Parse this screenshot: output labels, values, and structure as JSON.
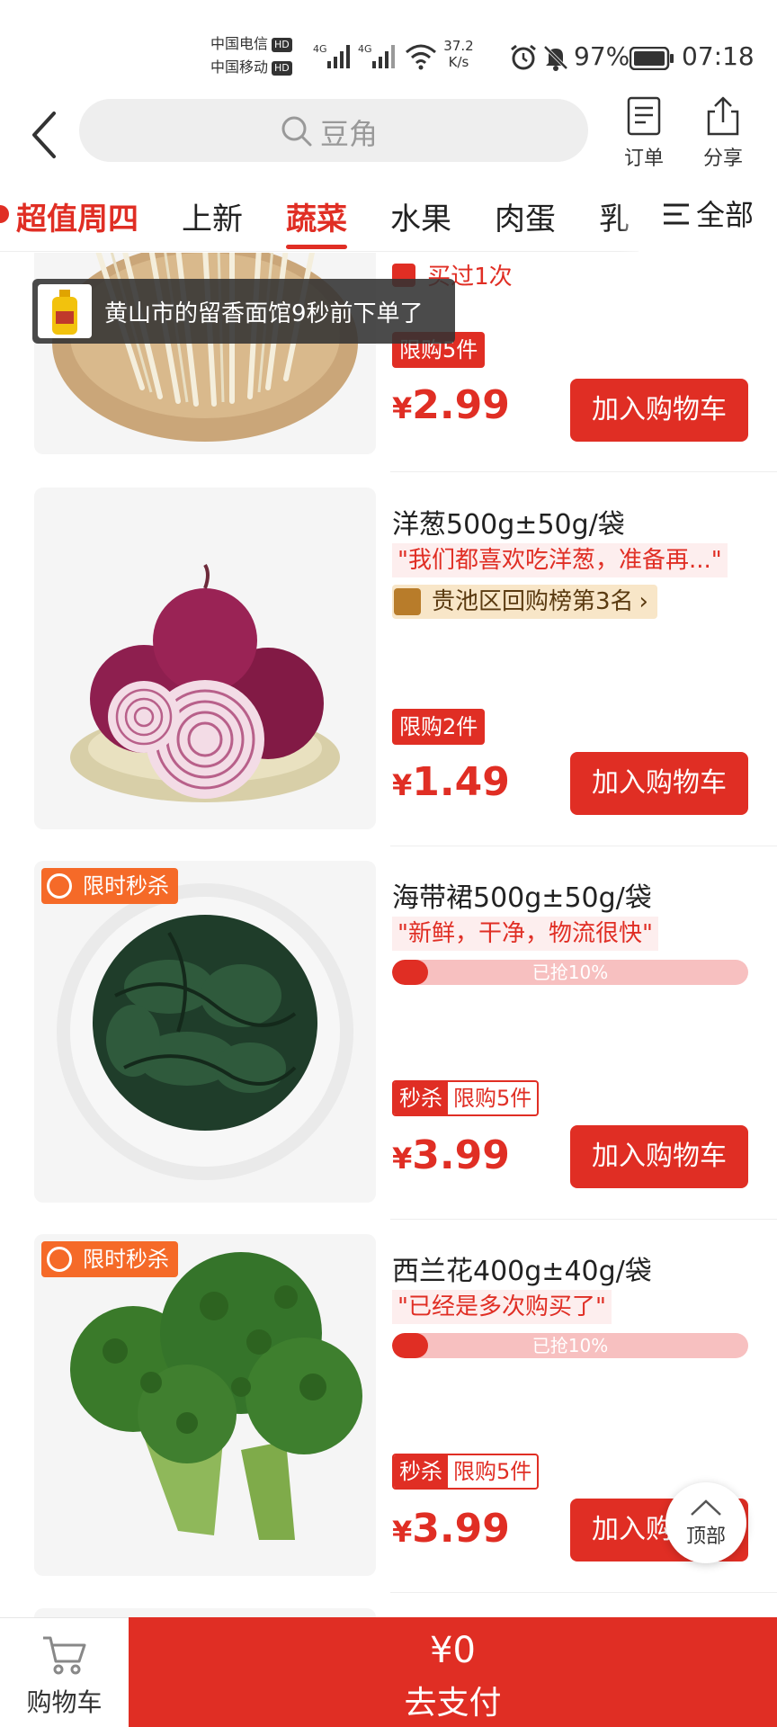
{
  "status": {
    "carrier1": "中国电信",
    "carrier2": "中国移动",
    "hd": "HD",
    "net1": "4G",
    "net2": "4G",
    "speed_val": "37.2",
    "speed_unit": "K/s",
    "battery": "97%",
    "time": "07:18"
  },
  "header": {
    "search_placeholder": "豆角",
    "orders_label": "订单",
    "share_label": "分享"
  },
  "categories": {
    "items": [
      "超值周四",
      "上新",
      "蔬菜",
      "水果",
      "肉蛋",
      "乳"
    ],
    "active": "蔬菜",
    "all_label": "全部"
  },
  "toast": {
    "text": "黄山市的留香面馆9秒前下单了"
  },
  "products": [
    {
      "bought_before": "买过1次",
      "limit": "限购5件",
      "currency": "¥",
      "price": "2.99",
      "add_label": "加入购物车"
    },
    {
      "name": "洋葱500g±50g/袋",
      "quote": "\"我们都喜欢吃洋葱，准备再...\"",
      "rank": "贵池区回购榜第3名",
      "limit": "限购2件",
      "currency": "¥",
      "price": "1.49",
      "add_label": "加入购物车"
    },
    {
      "flash_label": "限时秒杀",
      "name": "海带裙500g±50g/袋",
      "quote": "\"新鲜，干净，物流很快\"",
      "progress_text": "已抢10%",
      "progress": 0.1,
      "seckill": "秒杀",
      "limit": "限购5件",
      "currency": "¥",
      "price": "3.99",
      "add_label": "加入购物车"
    },
    {
      "flash_label": "限时秒杀",
      "name": "西兰花400g±40g/袋",
      "quote": "\"已经是多次购买了\"",
      "progress_text": "已抢10%",
      "progress": 0.1,
      "seckill": "秒杀",
      "limit": "限购5件",
      "currency": "¥",
      "price": "3.99",
      "add_label": "加入购物车"
    }
  ],
  "top_button": "顶部",
  "bottom": {
    "cart_label": "购物车",
    "total": "¥0",
    "pay_label": "去支付"
  },
  "colors": {
    "accent": "#e02e24",
    "flash": "#f56a28",
    "progress_bg": "#f7c0c0"
  }
}
